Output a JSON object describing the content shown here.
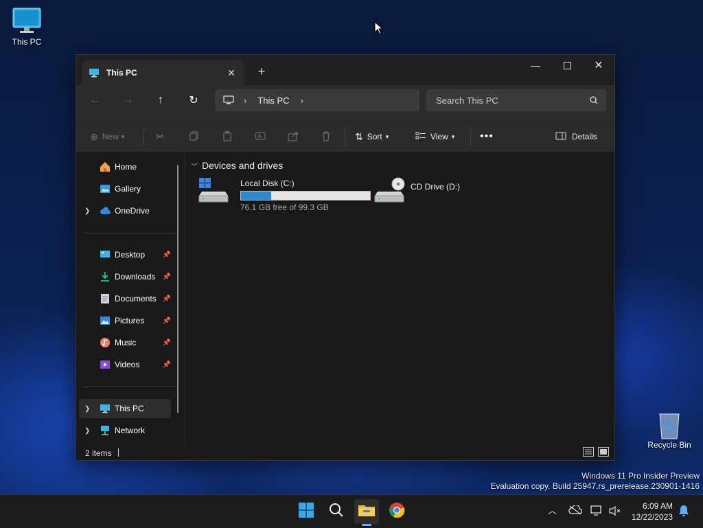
{
  "desktop": {
    "this_pc_label": "This PC",
    "recycle_bin_label": "Recycle Bin"
  },
  "window": {
    "tab_title": "This PC",
    "address": {
      "segment": "This PC"
    },
    "search": {
      "placeholder": "Search This PC"
    },
    "commands": {
      "new": "New",
      "sort": "Sort",
      "view": "View",
      "details": "Details"
    },
    "sidebar": {
      "top": [
        {
          "label": "Home",
          "icon": "home-icon"
        },
        {
          "label": "Gallery",
          "icon": "gallery-icon"
        },
        {
          "label": "OneDrive",
          "icon": "cloud-icon"
        }
      ],
      "pinned": [
        {
          "label": "Desktop",
          "icon": "desktop-folder-icon"
        },
        {
          "label": "Downloads",
          "icon": "download-icon"
        },
        {
          "label": "Documents",
          "icon": "document-icon"
        },
        {
          "label": "Pictures",
          "icon": "pictures-icon"
        },
        {
          "label": "Music",
          "icon": "music-icon"
        },
        {
          "label": "Videos",
          "icon": "video-icon"
        }
      ],
      "bottom": [
        {
          "label": "This PC",
          "icon": "computer-icon",
          "selected": true
        },
        {
          "label": "Network",
          "icon": "network-icon"
        }
      ]
    },
    "group_header": "Devices and drives",
    "drives": [
      {
        "name": "Local Disk (C:)",
        "free_text": "76.1 GB free of 99.3 GB",
        "used_fraction": 0.234
      },
      {
        "name": "CD Drive (D:)"
      }
    ],
    "status": {
      "item_count": "2 items"
    }
  },
  "watermark": {
    "line1": "Windows 11 Pro Insider Preview",
    "line2": "Evaluation copy. Build 25947.rs_prerelease.230901-1416"
  },
  "taskbar": {
    "time": "6:09 AM",
    "date": "12/22/2023"
  },
  "colors": {
    "accent": "#2a8ad4",
    "window_bg": "#191919",
    "toolbar_bg": "#2b2b2b"
  }
}
